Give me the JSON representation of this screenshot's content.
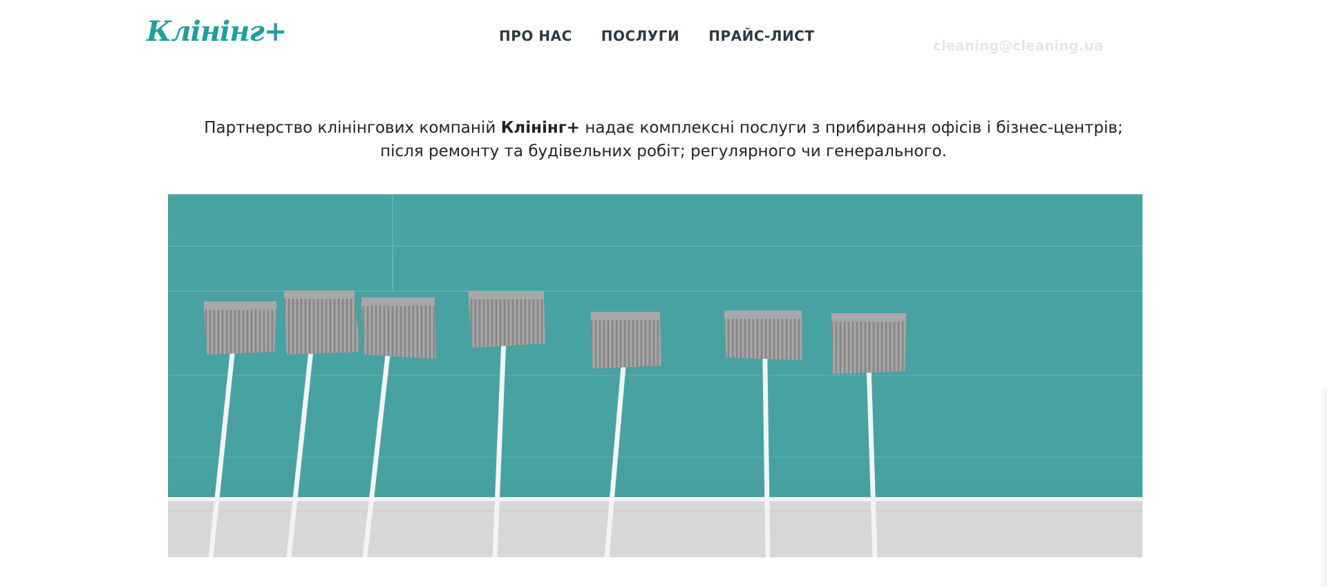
{
  "header": {
    "logo_text": "Клінінг+",
    "nav": [
      {
        "label": "ПРО НАС"
      },
      {
        "label": "ПОСЛУГИ"
      },
      {
        "label": "ПРАЙС-ЛИСТ"
      }
    ],
    "faded_text": "cleaning@cleaning.ua"
  },
  "intro": {
    "line1_before": "Партнерство клінінгових компаній ",
    "brand": "Клінінг+",
    "line1_after": " надає комплексні послуги з прибирання офісів і бізнес-центрів;",
    "line2": "після ремонту та будівельних робіт; регулярного чи генерального."
  },
  "hero": {
    "image_subject": "mops-against-teal-wall",
    "wall_color": "#4aa3a3",
    "floor_color": "#d9d9d9"
  },
  "colors": {
    "brand": "#1f9f9f",
    "nav_text": "#2b3a40",
    "body_text": "#1f2326"
  }
}
